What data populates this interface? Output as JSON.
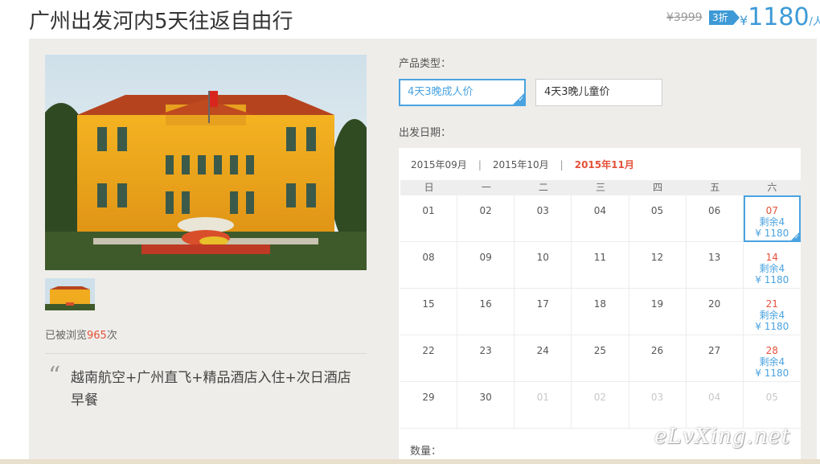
{
  "header": {
    "title": "广州出发河内5天往返自由行",
    "old_price": "¥3999",
    "discount": "3折",
    "price_symbol": "¥",
    "price": "1180",
    "price_unit": "/人"
  },
  "gallery": {
    "views_prefix": "已被浏览",
    "views_count": "965",
    "views_suffix": "次"
  },
  "description": {
    "quote_mark": "“",
    "text": "越南航空+广州直飞+精品酒店入住+次日酒店早餐"
  },
  "product_type": {
    "label": "产品类型：",
    "options": [
      {
        "label": "4天3晚成人价",
        "selected": true
      },
      {
        "label": "4天3晚儿童价",
        "selected": false
      }
    ]
  },
  "departure": {
    "label": "出发日期：",
    "months": [
      "2015年09月",
      "2015年10月",
      "2015年11月"
    ],
    "month_separator": "|",
    "active_month": "2015年11月",
    "weekdays": [
      "日",
      "一",
      "二",
      "三",
      "四",
      "五",
      "六"
    ],
    "remaining": "剩余4",
    "price": "¥ 1180",
    "weeks": [
      [
        {
          "d": "01"
        },
        {
          "d": "02"
        },
        {
          "d": "03"
        },
        {
          "d": "04"
        },
        {
          "d": "05"
        },
        {
          "d": "06"
        },
        {
          "d": "07",
          "avail": true,
          "selected": true
        }
      ],
      [
        {
          "d": "08"
        },
        {
          "d": "09"
        },
        {
          "d": "10"
        },
        {
          "d": "11"
        },
        {
          "d": "12"
        },
        {
          "d": "13"
        },
        {
          "d": "14",
          "avail": true
        }
      ],
      [
        {
          "d": "15"
        },
        {
          "d": "16"
        },
        {
          "d": "17"
        },
        {
          "d": "18"
        },
        {
          "d": "19"
        },
        {
          "d": "20"
        },
        {
          "d": "21",
          "avail": true
        }
      ],
      [
        {
          "d": "22"
        },
        {
          "d": "23"
        },
        {
          "d": "24"
        },
        {
          "d": "25"
        },
        {
          "d": "26"
        },
        {
          "d": "27"
        },
        {
          "d": "28",
          "avail": true
        }
      ],
      [
        {
          "d": "29"
        },
        {
          "d": "30"
        },
        {
          "d": "01",
          "dim": true
        },
        {
          "d": "02",
          "dim": true
        },
        {
          "d": "03",
          "dim": true
        },
        {
          "d": "04",
          "dim": true
        },
        {
          "d": "05",
          "dim": true
        }
      ]
    ]
  },
  "quantity": {
    "label": "数量："
  },
  "watermark": "eLvXing.net",
  "colors": {
    "accent": "#4aa3e0",
    "highlight": "#e4513a",
    "panel_bg": "#eeedea"
  }
}
